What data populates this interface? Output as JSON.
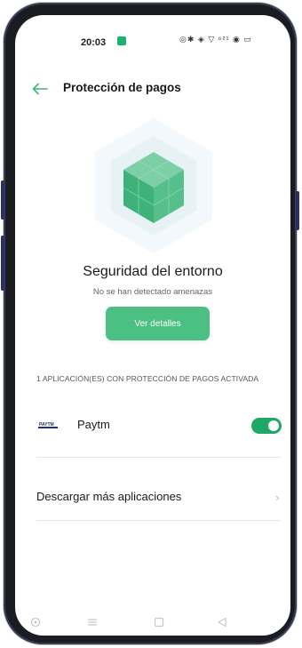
{
  "status_bar": {
    "time": "20:03",
    "icons": "◎✱ ◈ ▽ ⁶²¹ ◉ ▭"
  },
  "header": {
    "back_icon": "arrow-left-icon",
    "title": "Protección de pagos"
  },
  "hero": {
    "icon": "shield-cube-icon",
    "headline": "Seguridad del entorno",
    "subtitle": "No se han detectado amenazas",
    "details_button": "Ver detalles"
  },
  "protected_apps": {
    "section_label": "1 APLICACIÓN(ES) CON PROTECCIÓN DE PAGOS ACTIVADA",
    "items": [
      {
        "name": "Paytm",
        "logo_text": "PAYTM",
        "enabled": true
      }
    ]
  },
  "download": {
    "label": "Descargar más aplicaciones",
    "chevron": "›"
  },
  "colors": {
    "accent": "#4cbf82",
    "toggle_on": "#1fa865",
    "status_app_icon": "#18b36d"
  }
}
